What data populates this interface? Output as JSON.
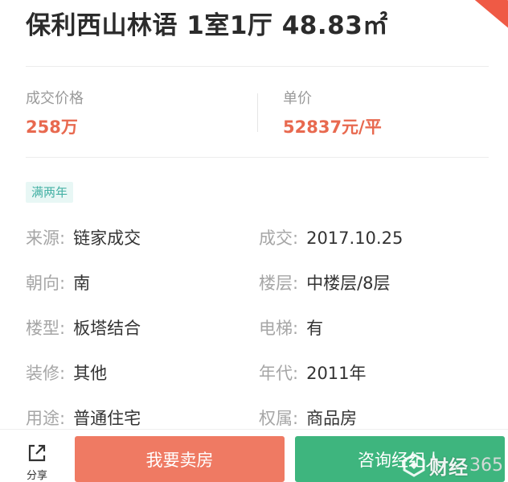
{
  "listing": {
    "title": "保利西山林语 1室1厅 48.83㎡"
  },
  "price": {
    "deal_label": "成交价格",
    "deal_value": "258万",
    "unit_label": "单价",
    "unit_value": "52837元/平"
  },
  "tag": "满两年",
  "info": [
    {
      "left_key": "来源:",
      "left_val": "链家成交",
      "right_key": "成交:",
      "right_val": "2017.10.25"
    },
    {
      "left_key": "朝向:",
      "left_val": "南",
      "right_key": "楼层:",
      "right_val": "中楼层/8层"
    },
    {
      "left_key": "楼型:",
      "left_val": "板塔结合",
      "right_key": "电梯:",
      "right_val": "有"
    },
    {
      "left_key": "装修:",
      "left_val": "其他",
      "right_key": "年代:",
      "right_val": "2011年"
    },
    {
      "left_key": "用途:",
      "left_val": "普通住宅",
      "right_key": "权属:",
      "right_val": "商品房"
    }
  ],
  "bottom": {
    "share_label": "分享",
    "share_icon": "share-icon",
    "sell_button": "我要卖房",
    "consult_button": "咨询经纪人"
  },
  "watermark": {
    "text": "财经",
    "number": "365"
  },
  "colors": {
    "accent_red": "#e8694f",
    "sell_button": "#ef7a63",
    "consult_button": "#3eb57e",
    "tag_text": "#43b0a4",
    "tag_bg": "#e8f7f5"
  }
}
